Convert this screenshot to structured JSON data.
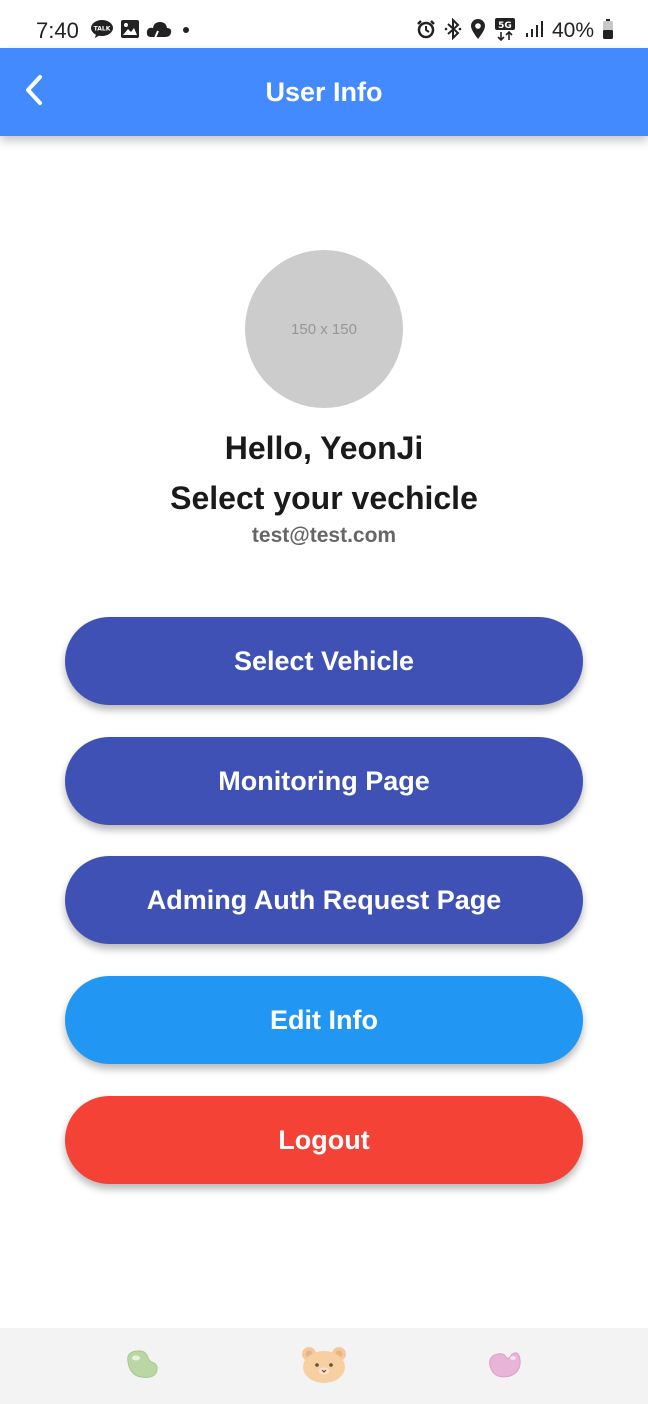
{
  "status_bar": {
    "time": "7:40",
    "battery": "40%",
    "left_icons": [
      "kakaotalk-icon",
      "gallery-icon",
      "cloud-icon",
      "dot-icon"
    ],
    "right_icons": [
      "alarm-icon",
      "bluetooth-icon",
      "location-icon",
      "5g-icon",
      "signal-icon",
      "battery-icon"
    ]
  },
  "app_bar": {
    "title": "User Info",
    "back_icon": "chevron-left-icon",
    "color": "#448aff"
  },
  "profile": {
    "avatar_placeholder": "150 x 150",
    "greeting": "Hello, YeonJi",
    "subtitle": "Select your vechicle",
    "email": "test@test.com"
  },
  "buttons": {
    "select_vehicle": "Select Vehicle",
    "monitoring": "Monitoring Page",
    "admin_auth": "Adming Auth Request Page",
    "edit_info": "Edit Info",
    "logout": "Logout"
  },
  "colors": {
    "primary_button": "#3f51b5",
    "edit_button": "#2196f3",
    "logout_button": "#f44336",
    "bottom_bar": "#f3f3f3"
  },
  "bottom_nav": {
    "items": [
      "green-jellybean-icon",
      "bear-face-icon",
      "pink-jellybean-icon"
    ]
  }
}
